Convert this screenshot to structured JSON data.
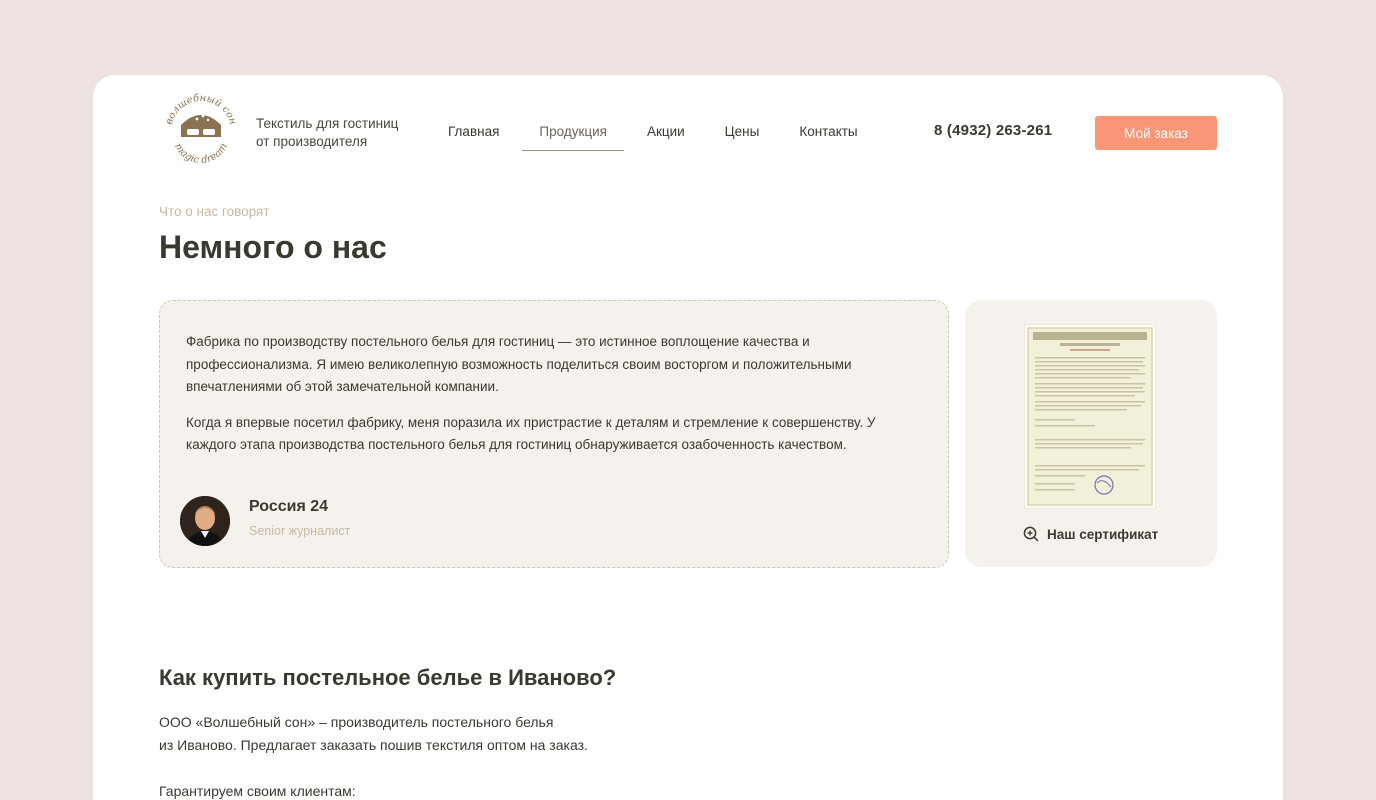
{
  "header": {
    "logo": {
      "text_top": "волшебный сон",
      "text_bottom": "magic dream"
    },
    "tagline": [
      "Текстиль для гостиниц",
      "от производителя"
    ],
    "nav": [
      {
        "label": "Главная",
        "active": false
      },
      {
        "label": "Продукция",
        "active": true
      },
      {
        "label": "Акции",
        "active": false
      },
      {
        "label": "Цены",
        "active": false
      },
      {
        "label": "Контакты",
        "active": false
      }
    ],
    "phone": "8 (4932) 263-261",
    "order_button": "Мой заказ"
  },
  "about": {
    "eyebrow": "Что о нас говорят",
    "title": "Немного о нас",
    "review": {
      "paragraphs": [
        "Фабрика по производству постельного белья для гостиниц — это истинное воплощение качества и профессионализма. Я имею великолепную возможность поделиться своим восторгом и положительными впечатлениями об этой замечательной компании.",
        "Когда я впервые посетил фабрику, меня поразила их пристрастие к деталям и стремление к совершенству. У каждого этапа производства постельного белья для гостиниц обнаруживается озабоченность качеством."
      ],
      "author_name": "Россия 24",
      "author_role": "Senior журналист"
    },
    "certificate": {
      "button_label": "Наш сертификат"
    }
  },
  "buy": {
    "title": "Как купить постельное белье в Иваново?",
    "lines": [
      "ООО «Волшебный сон» – производитель постельного белья",
      "из Иваново. Предлагает заказать пошив текстиля оптом на заказ."
    ],
    "guarantee": "Гарантируем своим клиентам:"
  },
  "colors": {
    "background": "#ede2df",
    "accent": "#f99677",
    "text": "#3b3830",
    "muted": "#c6b9a4",
    "card": "#f5f2ed",
    "logo": "#8a7350"
  }
}
